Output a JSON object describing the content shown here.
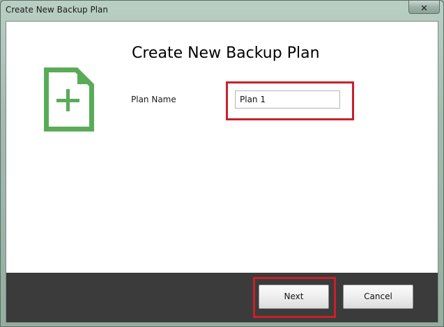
{
  "window": {
    "title": "Create New Backup Plan",
    "close_label": "✕"
  },
  "main": {
    "heading": "Create New Backup Plan",
    "plan_name_label": "Plan Name",
    "plan_name_value": "Plan 1",
    "icon": "new-document-plus-icon"
  },
  "footer": {
    "next_label": "Next",
    "cancel_label": "Cancel"
  },
  "colors": {
    "accent_green": "#5aab58",
    "highlight_red": "#c8202a",
    "footer_bg": "#3b3b3b"
  }
}
